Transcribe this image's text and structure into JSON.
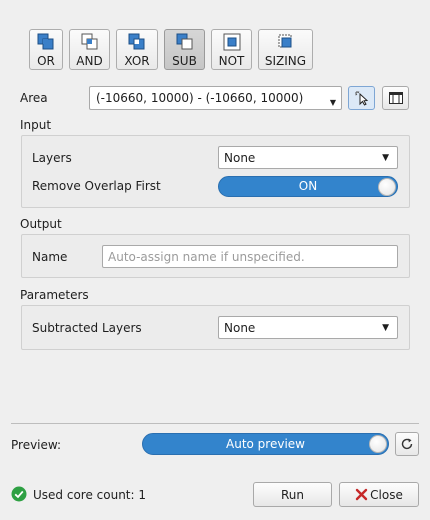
{
  "operations": [
    {
      "label": "OR",
      "icon": "or-op-icon",
      "active": false
    },
    {
      "label": "AND",
      "icon": "and-op-icon",
      "active": false
    },
    {
      "label": "XOR",
      "icon": "xor-op-icon",
      "active": false
    },
    {
      "label": "SUB",
      "icon": "sub-op-icon",
      "active": true
    },
    {
      "label": "NOT",
      "icon": "not-op-icon",
      "active": false
    },
    {
      "label": "SIZING",
      "icon": "sizing-op-icon",
      "active": false
    }
  ],
  "area": {
    "label": "Area",
    "value": "(-10660, 10000) - (-10660, 10000)",
    "pick_icon": "pick-area-icon",
    "layout_icon": "layout-view-icon"
  },
  "input": {
    "section": "Input",
    "layers_label": "Layers",
    "layers_value": "None",
    "remove_overlap_label": "Remove Overlap First",
    "remove_overlap_state": "ON"
  },
  "output": {
    "section": "Output",
    "name_label": "Name",
    "name_value": "",
    "name_placeholder": "Auto-assign name if unspecified."
  },
  "parameters": {
    "section": "Parameters",
    "subtracted_label": "Subtracted Layers",
    "subtracted_value": "None"
  },
  "preview": {
    "label": "Preview:",
    "toggle_text": "Auto preview",
    "refresh_icon": "refresh-icon"
  },
  "footer": {
    "status_text": "Used core count: 1",
    "status_icon": "check-circle-icon",
    "status_color": "#2ea043",
    "run_label": "Run",
    "close_label": "Close",
    "close_icon": "close-x-icon"
  },
  "colors": {
    "accent": "#3384cc",
    "close_icon_color": "#c62828"
  }
}
